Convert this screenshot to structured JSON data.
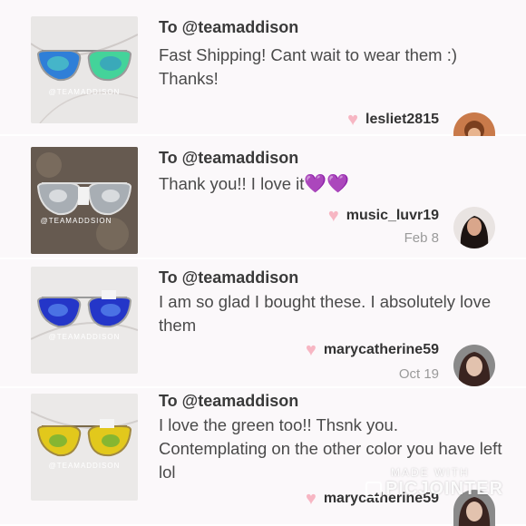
{
  "reviews": [
    {
      "to": "To @teamaddison",
      "message": "Fast Shipping! Cant wait to wear them :) Thanks!",
      "username": "lesliet2815",
      "date": "",
      "photo_watermark": "@TEAMADDISON",
      "lens_color": "#2f7fd8",
      "lens_color_2": "#44d39a"
    },
    {
      "to": "To @teamaddison",
      "message": "Thank you!! I love it",
      "emoji": "💜💜",
      "username": "music_luvr19",
      "date": "Feb 8",
      "photo_watermark": "@TEAMADDSION",
      "lens_color": "#a8aeb4",
      "lens_color_2": "#e4e6e8"
    },
    {
      "to": "To @teamaddison",
      "message": "I am so glad I bought these. I absolutely love them",
      "username": "marycatherine59",
      "date": "Oct 19",
      "photo_watermark": "@TEAMADDISON",
      "lens_color": "#2436c8",
      "lens_color_2": "#5b8cf0"
    },
    {
      "to": "To @teamaddison",
      "message": "I love the green too!! Thsnk you. Contemplating on the other color you have left lol",
      "username": "marycatherine59",
      "date": "",
      "photo_watermark": "@TEAMADDISON",
      "lens_color": "#e2c81c",
      "lens_color_2": "#5fae3a"
    }
  ],
  "watermark": {
    "line1": "MADE WITH",
    "line2": "PICJOINTER"
  },
  "colors": {
    "card_bg": "#fbf8fa",
    "heart": "#f7b6c3",
    "purple_heart": "#a23be0"
  }
}
